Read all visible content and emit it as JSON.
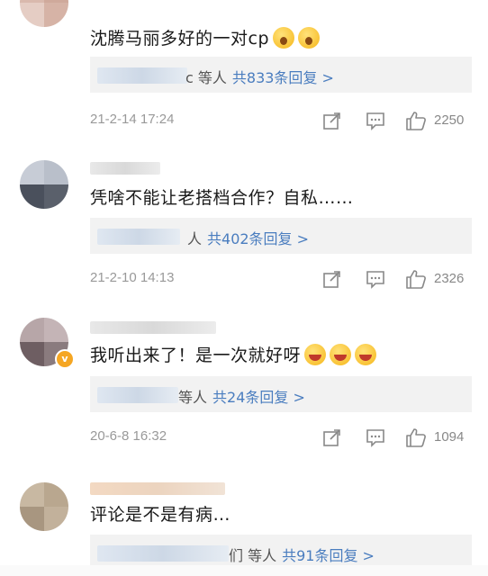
{
  "comments": [
    {
      "text": "沈腾马丽多好的一对cp",
      "emoji": [
        "scream-face",
        "scream-face"
      ],
      "reply_suffix": "c 等人",
      "reply_count": "共833条回复 >",
      "time": "21-2-14 17:24",
      "likes": "2250"
    },
    {
      "text": "凭啥不能让老搭档合作？自私……",
      "emoji": [],
      "reply_suffix": "人",
      "reply_count": "共402条回复 >",
      "time": "21-2-10 14:13",
      "likes": "2326"
    },
    {
      "text": "我听出来了！是一次就好呀",
      "emoji": [
        "laughing-face",
        "laughing-face",
        "laughing-face"
      ],
      "reply_suffix": "等人",
      "reply_count": "共24条回复 >",
      "time": "20-6-8 16:32",
      "likes": "1094"
    },
    {
      "text": "评论是不是有病…",
      "emoji": [],
      "reply_suffix": "们 等人",
      "reply_count": "共91条回复 >",
      "time": "",
      "likes": ""
    }
  ],
  "icons": {
    "share": "share-icon",
    "comment": "comment-icon",
    "like": "thumbs-up-icon",
    "verified": "verified-badge-icon"
  },
  "verified_badge": "v",
  "colors": {
    "link_blue": "#4a7dbf",
    "meta_gray": "#999999",
    "reply_bg": "#f2f2f2",
    "badge_orange": "#f5a623"
  }
}
